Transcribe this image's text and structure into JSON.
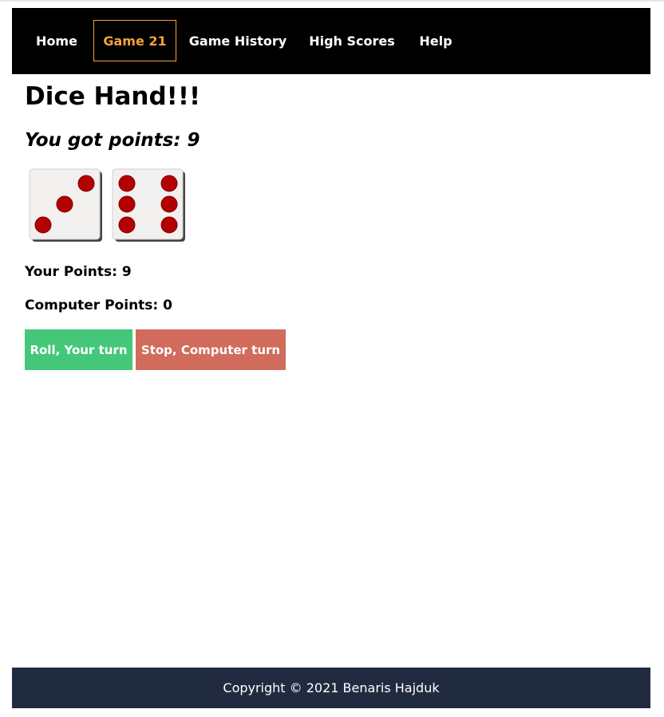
{
  "nav": {
    "items": [
      {
        "label": "Home",
        "active": false
      },
      {
        "label": "Game 21",
        "active": true
      },
      {
        "label": "Game History",
        "active": false
      },
      {
        "label": "High Scores",
        "active": false
      },
      {
        "label": "Help",
        "active": false
      }
    ]
  },
  "main": {
    "title": "Dice Hand!!!",
    "points_message": "You got points: 9",
    "dice": [
      3,
      6
    ],
    "your_points": "Your Points: 9",
    "computer_points": "Computer Points: 0",
    "roll_button": "Roll, Your turn",
    "stop_button": "Stop, Computer turn"
  },
  "footer": {
    "copyright": "Copyright © 2021 Benaris Hajduk"
  },
  "colors": {
    "nav_background": "#000000",
    "nav_active": "#f7a23a",
    "roll_button": "#44c779",
    "stop_button": "#d16b5c",
    "footer_background": "#212b40",
    "pip": "#b30000"
  }
}
